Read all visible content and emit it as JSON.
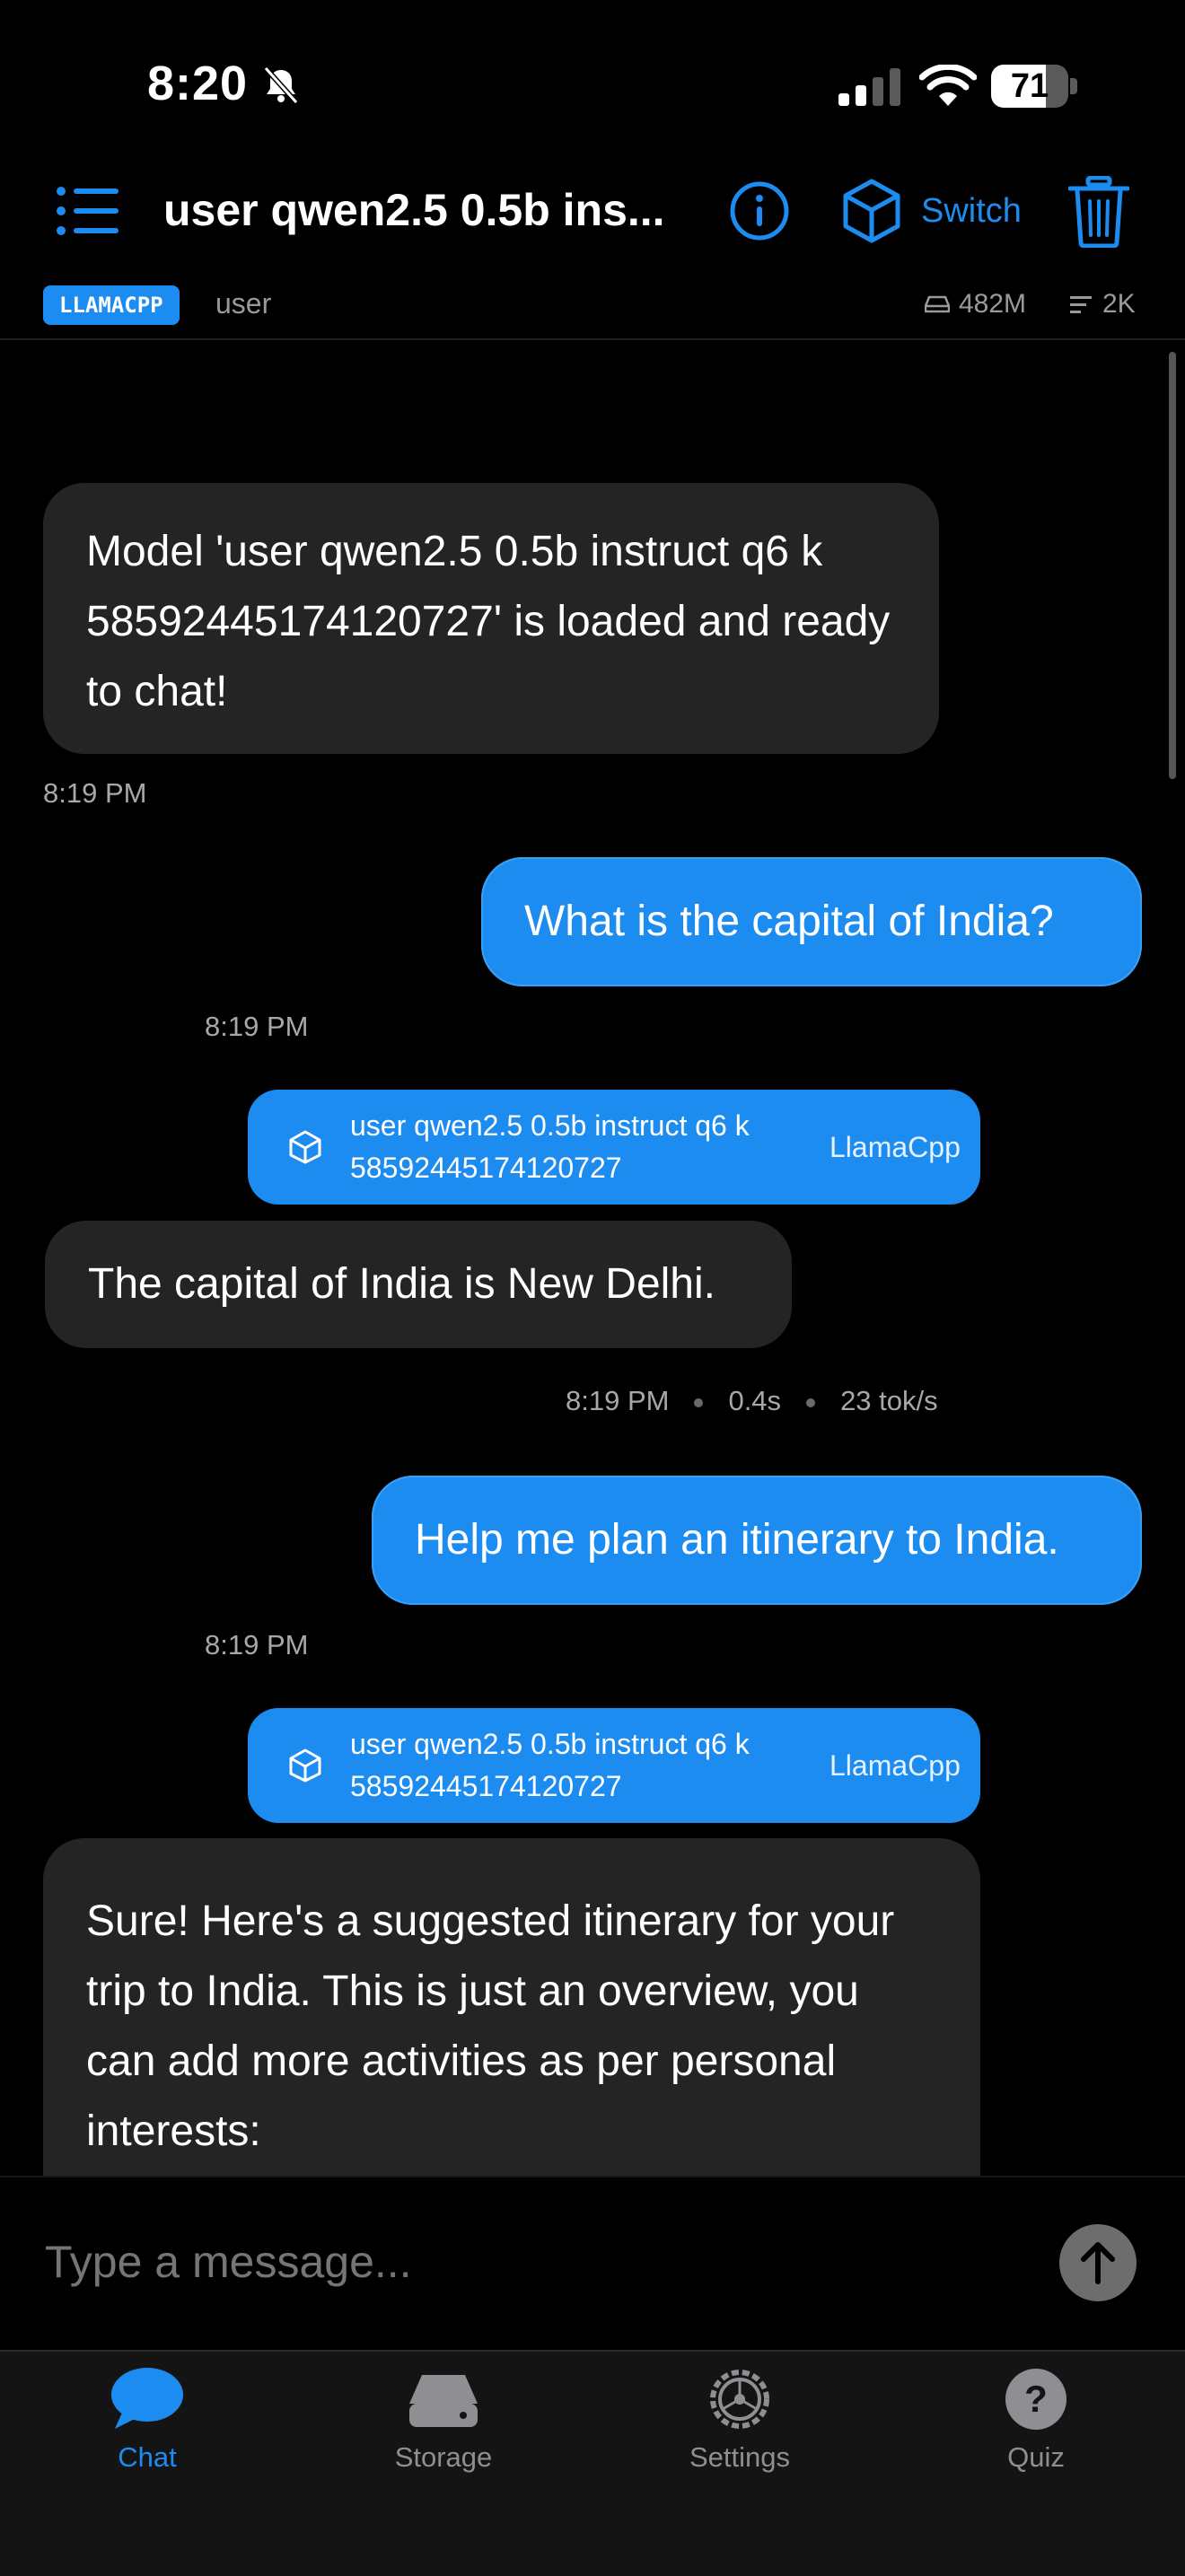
{
  "status_bar": {
    "time": "8:20",
    "battery": "71"
  },
  "header": {
    "title": "user qwen2.5 0.5b ins...",
    "switch_label": "Switch"
  },
  "sub_header": {
    "engine_badge": "LLAMACPP",
    "user": "user",
    "size": "482M",
    "context": "2K"
  },
  "messages": [
    {
      "role": "assistant",
      "text": "Model 'user qwen2.5 0.5b instruct q6 k 58592445174120727' is loaded and ready to chat!",
      "time": "8:19 PM"
    },
    {
      "role": "user",
      "text": "What is the capital of India?",
      "time": "8:19 PM"
    },
    {
      "role": "assistant",
      "model_name": "user qwen2.5 0.5b instruct q6 k 58592445174120727",
      "engine": "LlamaCpp",
      "text": "The capital of India is New Delhi.",
      "time": "8:19 PM",
      "duration": "0.4s",
      "speed": "23 tok/s"
    },
    {
      "role": "user",
      "text": "Help me plan an itinerary to India.",
      "time": "8:19 PM"
    },
    {
      "role": "assistant",
      "model_name": "user qwen2.5 0.5b instruct q6 k 58592445174120727",
      "engine": "LlamaCpp",
      "text": "Sure! Here's a suggested itinerary for your trip to India. This is just an overview, you can add more activities as per personal interests:"
    }
  ],
  "input": {
    "placeholder": "Type a message..."
  },
  "tabs": [
    {
      "label": "Chat",
      "icon": "chat-bubble-icon",
      "active": true
    },
    {
      "label": "Storage",
      "icon": "storage-drive-icon",
      "active": false
    },
    {
      "label": "Settings",
      "icon": "gear-icon",
      "active": false
    },
    {
      "label": "Quiz",
      "icon": "question-icon",
      "active": false
    }
  ],
  "colors": {
    "accent": "#1d8cf0",
    "background": "#000000",
    "ai_bubble": "#242424",
    "muted": "#9a9a9a"
  }
}
